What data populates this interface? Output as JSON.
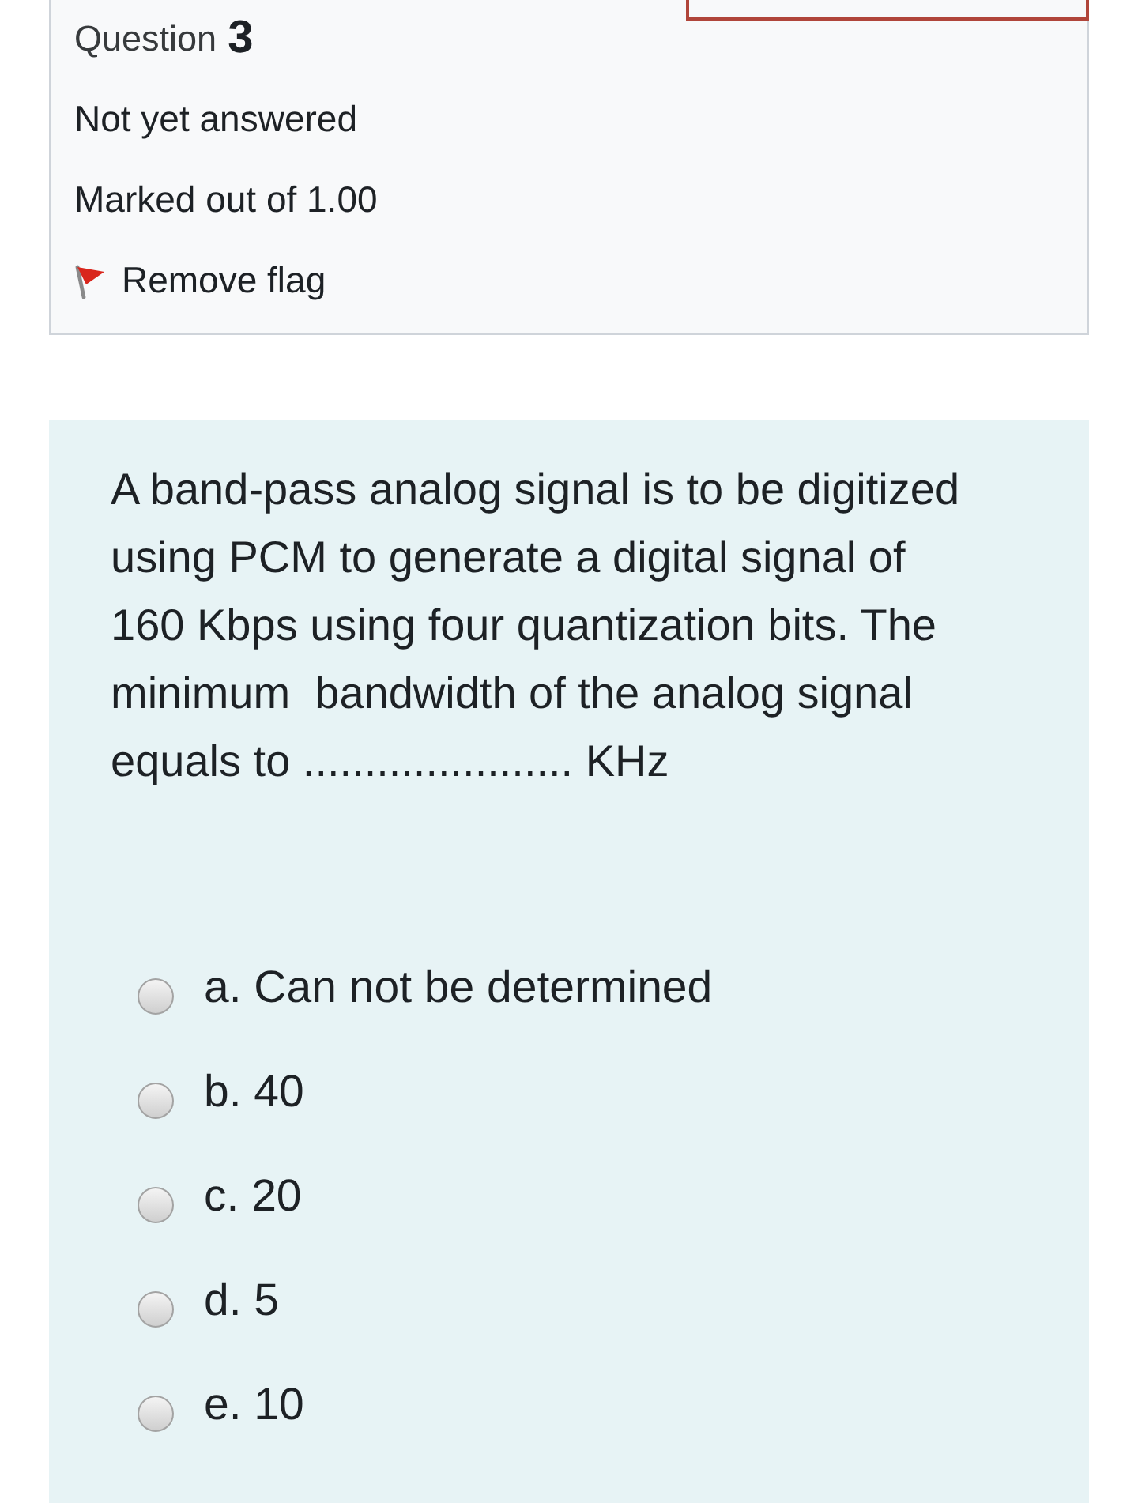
{
  "question_info": {
    "label": "Question",
    "number": "3",
    "status": "Not yet answered",
    "marks": "Marked out of 1.00",
    "flag": {
      "label": "Remove flag",
      "flagged": true
    }
  },
  "question": {
    "text": "A band-pass analog signal is to be digitized\nusing PCM to generate a digital signal of\n160 Kbps using four quantization bits. The\nminimum  bandwidth of the analog signal\nequals to ...................... KHz",
    "options": [
      {
        "label": "a. Can not be determined",
        "selected": false
      },
      {
        "label": "b. 40",
        "selected": false
      },
      {
        "label": "c. 20",
        "selected": false
      },
      {
        "label": "d. 5",
        "selected": false
      },
      {
        "label": "e. 10",
        "selected": false
      }
    ]
  }
}
